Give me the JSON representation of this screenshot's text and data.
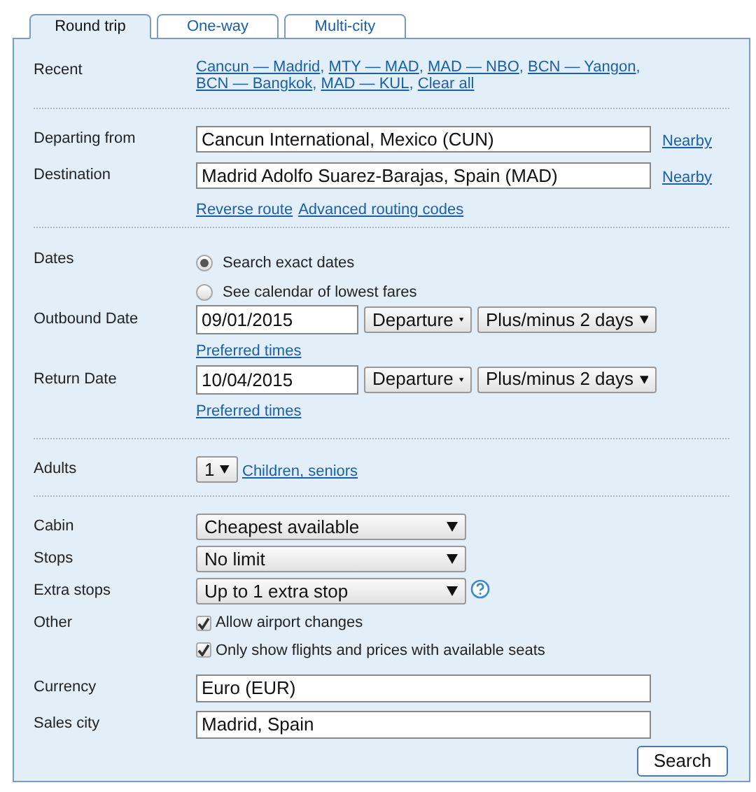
{
  "tabs": [
    {
      "label": "Round trip",
      "selected": true
    },
    {
      "label": "One-way",
      "selected": false
    },
    {
      "label": "Multi-city",
      "selected": false
    }
  ],
  "recent": {
    "label": "Recent",
    "separator": ",",
    "links": [
      "Cancun — Madrid",
      "MTY — MAD",
      "MAD — NBO",
      "BCN — Yangon",
      "BCN — Bangkok",
      "MAD — KUL",
      "Clear all"
    ]
  },
  "route": {
    "departing": {
      "label": "Departing from",
      "value": "Cancun International, Mexico (CUN)",
      "link": "Nearby"
    },
    "destination": {
      "label": "Destination",
      "value": "Madrid Adolfo Suarez-Barajas, Spain (MAD)",
      "link": "Nearby"
    },
    "links": [
      "Reverse route",
      "Advanced routing codes"
    ]
  },
  "dates": {
    "label": "Dates",
    "options": [
      {
        "label": "Search exact dates",
        "selected": true
      },
      {
        "label": "See calendar of lowest fares",
        "selected": false
      }
    ],
    "rows": [
      {
        "label": "Outbound Date",
        "value": "09/01/2015",
        "time": "Departure",
        "range": "Plus/minus 2 days",
        "link": "Preferred times"
      },
      {
        "label": "Return Date",
        "value": "10/04/2015",
        "time": "Departure",
        "range": "Plus/minus 2 days",
        "link": "Preferred times"
      }
    ]
  },
  "adults": {
    "label": "Adults",
    "value": "1",
    "link": "Children, seniors"
  },
  "options": [
    {
      "kind": "select",
      "label": "Cabin",
      "value": "Cheapest available"
    },
    {
      "kind": "select",
      "label": "Stops",
      "value": "No limit"
    },
    {
      "kind": "select",
      "label": "Extra stops",
      "value": "Up to 1 extra stop",
      "help": true
    },
    {
      "kind": "checks",
      "label": "Other",
      "items": [
        {
          "label": "Allow airport changes",
          "checked": true
        },
        {
          "label": "Only show flights and prices with available seats",
          "checked": true
        }
      ]
    },
    {
      "kind": "text",
      "label": "Currency",
      "value": "Euro (EUR)"
    },
    {
      "kind": "text",
      "label": "Sales city",
      "value": "Madrid, Spain"
    }
  ],
  "search_button": "Search"
}
